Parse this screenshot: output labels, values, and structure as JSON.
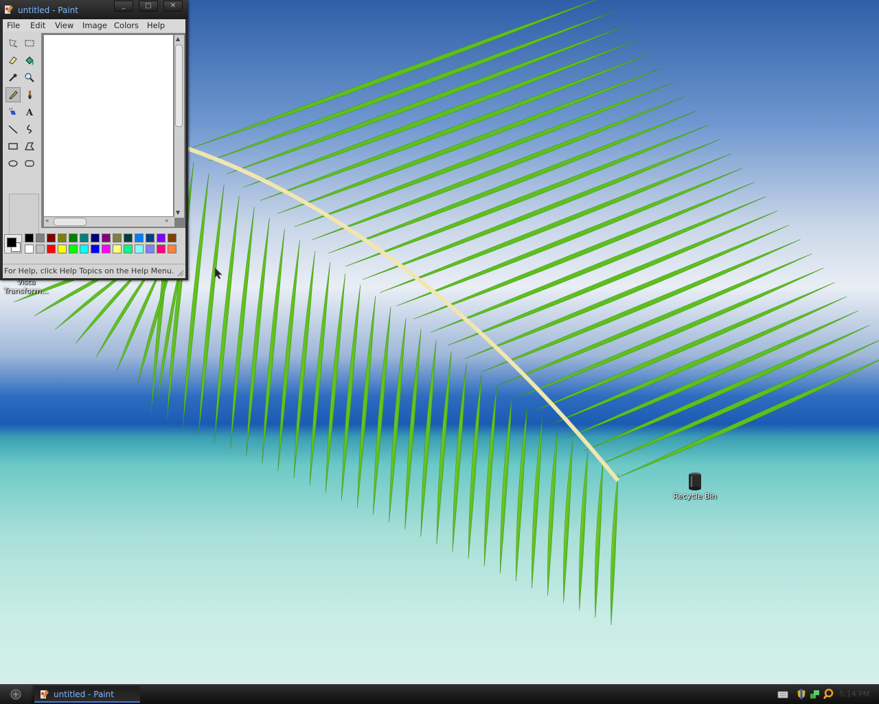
{
  "desktop": {
    "icons": [
      {
        "name": "vista-transform-icon",
        "label_lines": [
          "Vista",
          "Transform..."
        ]
      },
      {
        "name": "recycle-bin-icon",
        "label_lines": [
          "Recycle Bin"
        ]
      }
    ]
  },
  "paint": {
    "title": "untitled - Paint",
    "menu": [
      "File",
      "Edit",
      "View",
      "Image",
      "Colors",
      "Help"
    ],
    "tools": [
      "free-form-select",
      "select",
      "eraser",
      "fill-with-color",
      "pick-color",
      "magnifier",
      "pencil",
      "brush",
      "airbrush",
      "text",
      "line",
      "curve",
      "rectangle",
      "polygon",
      "ellipse",
      "rounded-rectangle"
    ],
    "active_tool": "pencil",
    "foreground_color": "#000000",
    "background_color": "#ffffff",
    "palette": {
      "row1": [
        "#000000",
        "#808080",
        "#800000",
        "#808000",
        "#008000",
        "#008080",
        "#000080",
        "#800080",
        "#808040",
        "#004040",
        "#0080ff",
        "#004080",
        "#8000ff",
        "#804000"
      ],
      "row2": [
        "#ffffff",
        "#c0c0c0",
        "#ff0000",
        "#ffff00",
        "#00ff00",
        "#00ffff",
        "#0000ff",
        "#ff00ff",
        "#ffff80",
        "#00ff80",
        "#80ffff",
        "#8080ff",
        "#ff0080",
        "#ff8040"
      ]
    },
    "status": "For Help, click Help Topics on the Help Menu."
  },
  "taskbar": {
    "task_label": "untitled - Paint",
    "clock": "5:14 PM"
  }
}
